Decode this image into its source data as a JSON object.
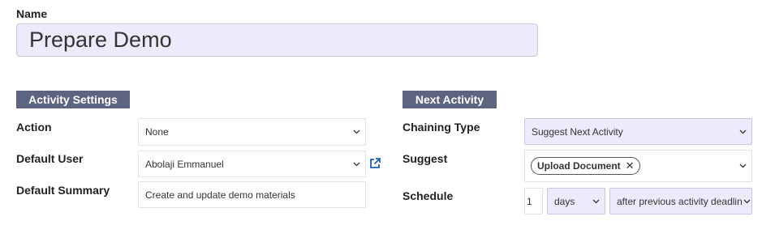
{
  "name": {
    "label": "Name",
    "value": "Prepare Demo"
  },
  "activity_settings": {
    "header": "Activity Settings",
    "action": {
      "label": "Action",
      "value": "None"
    },
    "default_user": {
      "label": "Default User",
      "value": "Abolaji Emmanuel"
    },
    "default_summary": {
      "label": "Default Summary",
      "value": "Create and update demo materials"
    }
  },
  "next_activity": {
    "header": "Next Activity",
    "chaining_type": {
      "label": "Chaining Type",
      "value": "Suggest Next Activity"
    },
    "suggest": {
      "label": "Suggest",
      "tags": [
        "Upload Document"
      ]
    },
    "schedule": {
      "label": "Schedule",
      "amount": "1",
      "unit": "days",
      "trigger": "after previous activity deadline"
    }
  },
  "colors": {
    "section_header": "#5c6480",
    "highlight_field": "#ecebfb",
    "link_icon": "#1f5fbf"
  }
}
